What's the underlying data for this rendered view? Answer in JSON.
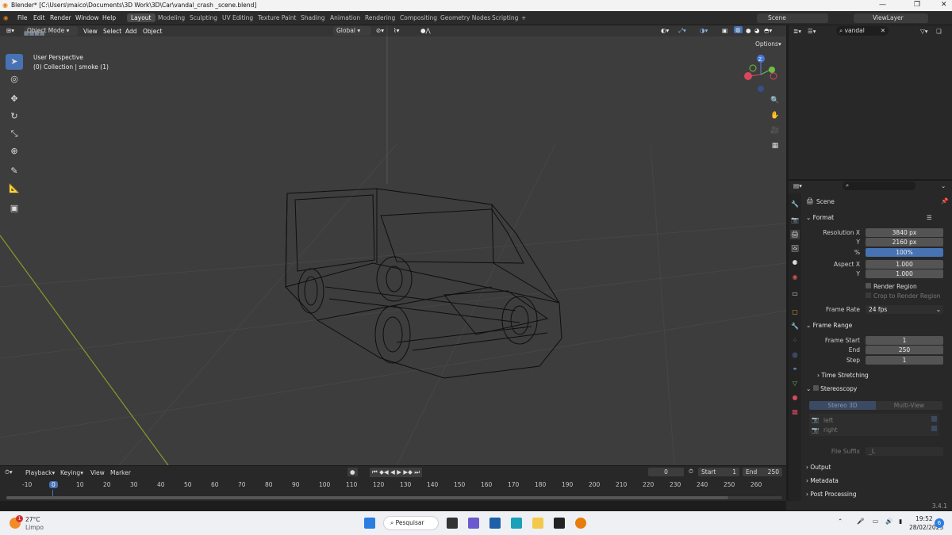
{
  "window": {
    "title": "Blender* [C:\\Users\\maico\\Documents\\3D Work\\3D\\Car\\vandal_crash _scene.blend]"
  },
  "menu": [
    "File",
    "Edit",
    "Render",
    "Window",
    "Help"
  ],
  "workspaces": [
    "Layout",
    "Modeling",
    "Sculpting",
    "UV Editing",
    "Texture Paint",
    "Shading",
    "Animation",
    "Rendering",
    "Compositing",
    "Geometry Nodes",
    "Scripting",
    "+"
  ],
  "scene_field": "Scene",
  "viewlayer_field": "ViewLayer",
  "viewport": {
    "mode": "Object Mode",
    "menus": [
      "View",
      "Select",
      "Add",
      "Object"
    ],
    "orientation": "Global",
    "options": "Options",
    "overlay_line1": "User Perspective",
    "overlay_line2": "(0) Collection | smoke (1)"
  },
  "gizmo": {
    "z": "Z"
  },
  "outliner": {
    "search": "vandal"
  },
  "properties": {
    "scene_label": "Scene",
    "format": "Format",
    "res_x_label": "Resolution X",
    "res_x": "3840 px",
    "res_y_label": "Y",
    "res_y": "2160 px",
    "pct_label": "%",
    "pct": "100%",
    "aspect_x_label": "Aspect X",
    "aspect_x": "1.000",
    "aspect_y_label": "Y",
    "aspect_y": "1.000",
    "render_region": "Render Region",
    "crop": "Crop to Render Region",
    "frame_rate_label": "Frame Rate",
    "frame_rate": "24 fps",
    "frame_range": "Frame Range",
    "fstart_label": "Frame Start",
    "fstart": "1",
    "fend_label": "End",
    "fend": "250",
    "fstep_label": "Step",
    "fstep": "1",
    "time_stretch": "Time Stretching",
    "stereoscopy": "Stereoscopy",
    "stereo3d": "Stereo 3D",
    "multiview": "Multi-View",
    "left": "left",
    "right": "right",
    "file_suffix_label": "File Suffix",
    "file_suffix": "_L",
    "output": "Output",
    "metadata": "Metadata",
    "post": "Post Processing"
  },
  "timeline": {
    "playback": "Playback",
    "keying": "Keying",
    "view": "View",
    "marker": "Marker",
    "current": "0",
    "start_label": "Start",
    "start": "1",
    "end_label": "End",
    "end": "250",
    "ticks": [
      "-10",
      "0",
      "10",
      "20",
      "30",
      "40",
      "50",
      "60",
      "70",
      "80",
      "90",
      "100",
      "110",
      "120",
      "130",
      "140",
      "150",
      "160",
      "170",
      "180",
      "190",
      "200",
      "210",
      "220",
      "230",
      "240",
      "250",
      "260"
    ]
  },
  "status": {
    "version": "3.4.1"
  },
  "taskbar": {
    "temp": "27°C",
    "weather": "Limpo",
    "search": "Pesquisar",
    "time": "19:52",
    "date": "28/02/2023",
    "badge": "1",
    "notif": "6"
  }
}
